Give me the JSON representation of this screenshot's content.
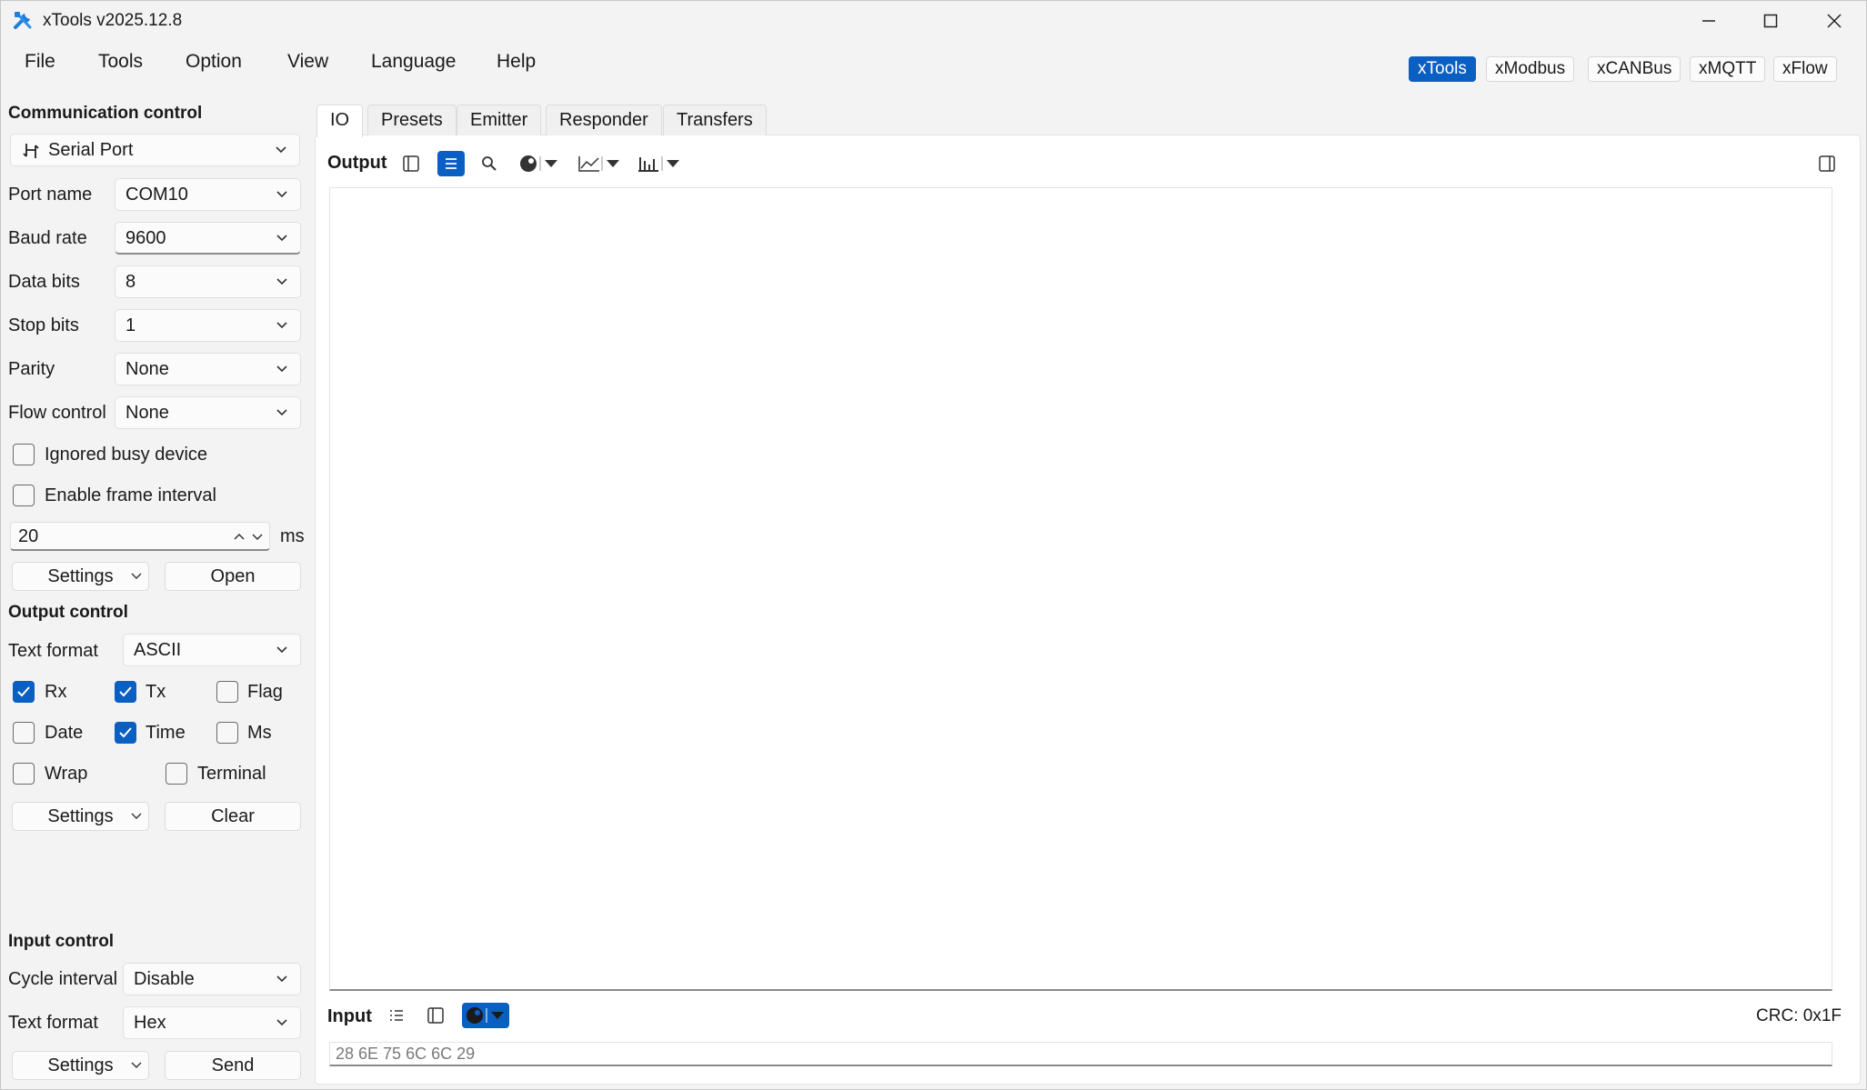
{
  "window": {
    "title": "xTools v2025.12.8",
    "accent": "#0a5fc2"
  },
  "menu": [
    "File",
    "Tools",
    "Option",
    "View",
    "Language",
    "Help"
  ],
  "tool_switch": [
    "xTools",
    "xModbus",
    "xCANBus",
    "xMQTT",
    "xFlow"
  ],
  "tool_switch_active": "xTools",
  "communication": {
    "title": "Communication control",
    "device": "Serial Port",
    "port_name_label": "Port name",
    "port_name": "COM10",
    "baud_rate_label": "Baud rate",
    "baud_rate": "9600",
    "data_bits_label": "Data bits",
    "data_bits": "8",
    "stop_bits_label": "Stop bits",
    "stop_bits": "1",
    "parity_label": "Parity",
    "parity": "None",
    "flow_control_label": "Flow control",
    "flow_control": "None",
    "ignored_busy_label": "Ignored busy device",
    "ignored_busy_checked": false,
    "frame_interval_label": "Enable frame interval",
    "frame_interval_checked": false,
    "interval_value": "20",
    "interval_unit": "ms",
    "settings_label": "Settings",
    "open_label": "Open"
  },
  "output_control": {
    "title": "Output control",
    "text_format_label": "Text format",
    "text_format": "ASCII",
    "rx_label": "Rx",
    "rx_checked": true,
    "tx_label": "Tx",
    "tx_checked": true,
    "flag_label": "Flag",
    "flag_checked": false,
    "date_label": "Date",
    "date_checked": false,
    "time_label": "Time",
    "time_checked": true,
    "ms_label": "Ms",
    "ms_checked": false,
    "wrap_label": "Wrap",
    "wrap_checked": false,
    "terminal_label": "Terminal",
    "terminal_checked": false,
    "settings_label": "Settings",
    "clear_label": "Clear"
  },
  "input_control": {
    "title": "Input control",
    "cycle_interval_label": "Cycle interval",
    "cycle_interval": "Disable",
    "text_format_label": "Text format",
    "text_format": "Hex",
    "settings_label": "Settings",
    "send_label": "Send"
  },
  "tabs": [
    "IO",
    "Presets",
    "Emitter",
    "Responder",
    "Transfers"
  ],
  "active_tab": "IO",
  "output": {
    "label": "Output"
  },
  "input": {
    "label": "Input",
    "crc": "CRC: 0x1F",
    "placeholder": "28 6E 75 6C 6C 29"
  }
}
